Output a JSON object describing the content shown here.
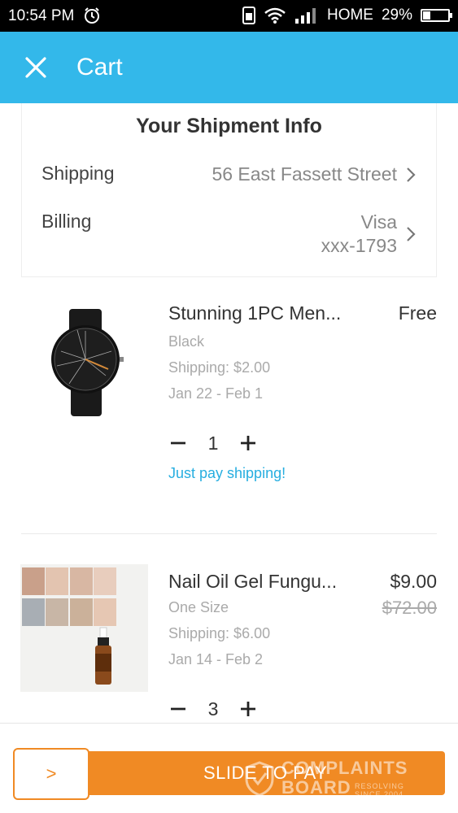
{
  "status_bar": {
    "time": "10:54 PM",
    "carrier": "HOME",
    "battery": "29%",
    "battery_level": 0.29
  },
  "app_bar": {
    "title": "Cart",
    "close_icon": "close-icon"
  },
  "shipment": {
    "title": "Your Shipment Info",
    "shipping_label": "Shipping",
    "shipping_value": "56 East Fassett Street",
    "billing_label": "Billing",
    "billing_value_line1": "Visa",
    "billing_value_line2": "xxx-1793"
  },
  "items": [
    {
      "name": "Stunning   1PC Men...",
      "price": "Free",
      "variant": "Black",
      "shipping": "Shipping: $2.00",
      "delivery": "Jan 22 - Feb 1",
      "quantity": "1",
      "promo": "Just pay shipping!"
    },
    {
      "name": "Nail Oil Gel Fungu...",
      "price": "$9.00",
      "original_price": "$72.00",
      "variant": "One Size",
      "shipping": "Shipping: $6.00",
      "delivery": "Jan 14 - Feb 2",
      "quantity": "3"
    }
  ],
  "checkout": {
    "handle_label": ">",
    "slide_label": "SLIDE TO PAY",
    "accent_color": "#f08a24"
  },
  "watermark": {
    "line1": "COMPLAINTS",
    "line2": "BOARD",
    "tag1": "RESOLVING",
    "tag2": "SINCE 2004"
  },
  "theme": {
    "app_bar_color": "#33b8ea",
    "link_color": "#27aee0"
  }
}
